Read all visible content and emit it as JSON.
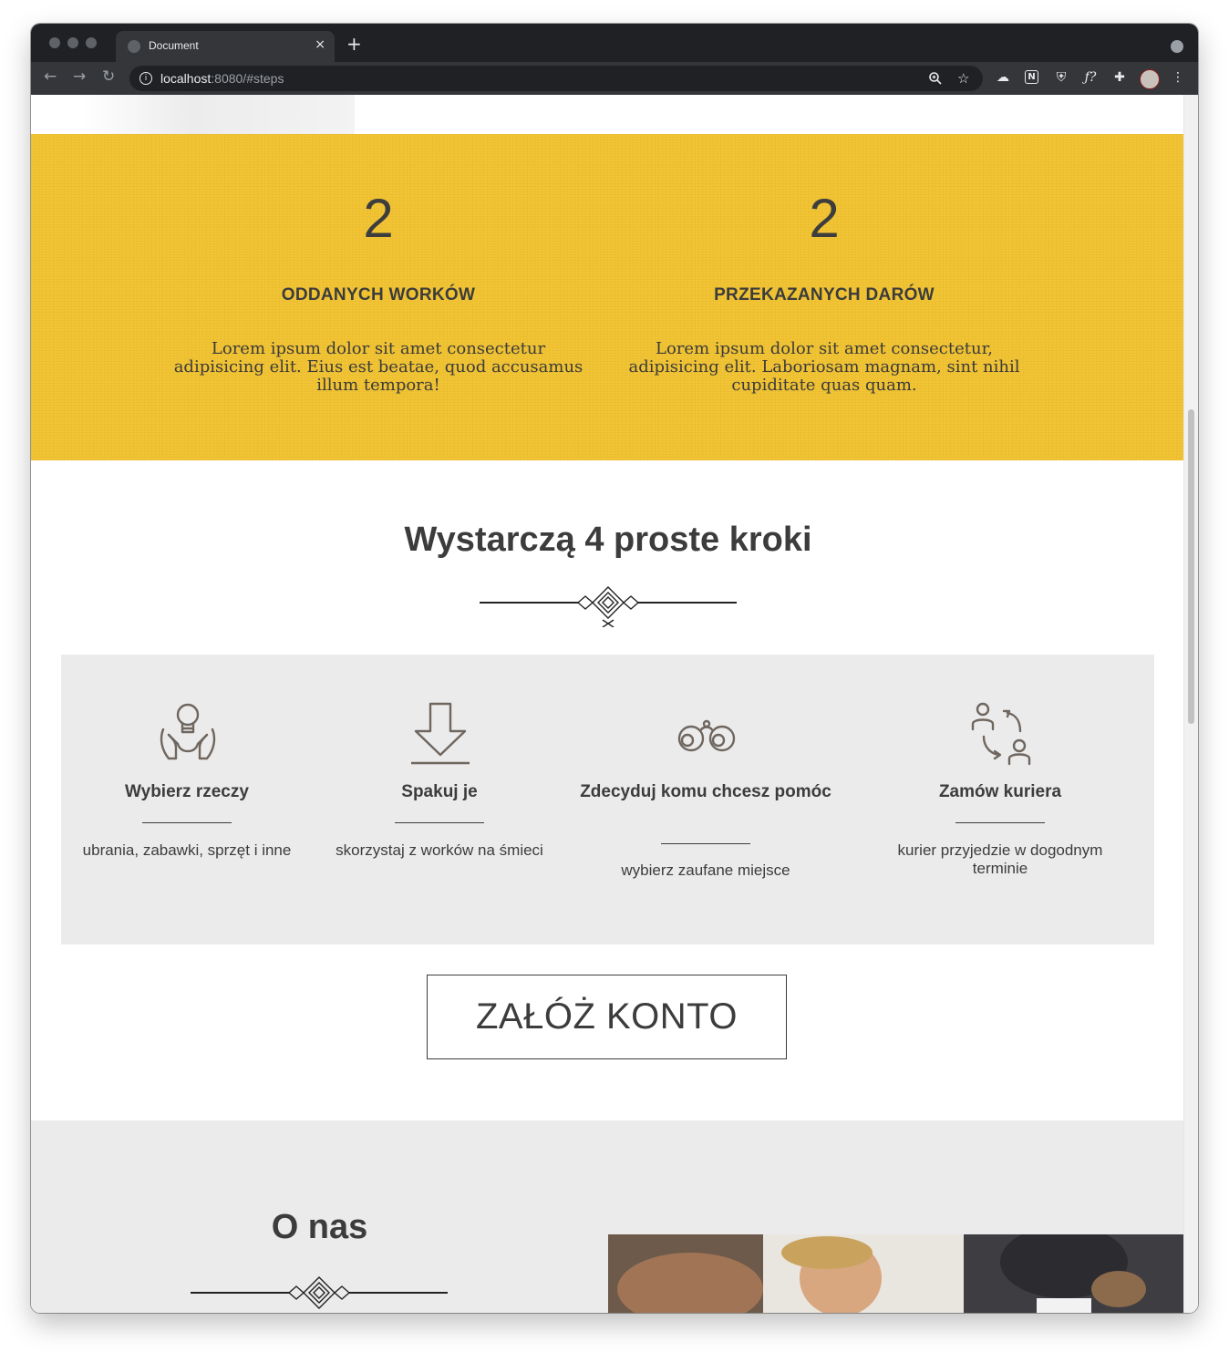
{
  "browser": {
    "tab_title": "Document",
    "tab_close": "×",
    "new_tab": "+",
    "url_host": "localhost",
    "url_rest": ":8080/#steps",
    "back": "←",
    "forward": "→",
    "reload": "↻"
  },
  "stats": {
    "background_color": "#f2c434",
    "items": [
      {
        "number": "2",
        "label": "ODDANYCH WORKÓW",
        "description": "Lorem ipsum dolor sit amet consectetur adipisicing elit. Eius est beatae, quod accusamus illum tempora!"
      },
      {
        "number": "2",
        "label": "PRZEKAZANYCH DARÓW",
        "description": "Lorem ipsum dolor sit amet consectetur, adipisicing elit. Laboriosam magnam, sint nihil cupiditate quas quam."
      }
    ]
  },
  "steps": {
    "title": "Wystarczą 4 proste kroki",
    "items": [
      {
        "icon": "hands-lightbulb-icon",
        "title": "Wybierz rzeczy",
        "description": "ubrania, zabawki, sprzęt i inne"
      },
      {
        "icon": "download-arrow-icon",
        "title": "Spakuj je",
        "description": "skorzystaj z worków na śmieci"
      },
      {
        "icon": "binoculars-icon",
        "title": "Zdecyduj komu chcesz pomóc",
        "description": "wybierz zaufane miejsce"
      },
      {
        "icon": "people-exchange-icon",
        "title": "Zamów kuriera",
        "description": "kurier przyjedzie w dogodnym terminie"
      }
    ]
  },
  "cta": {
    "label": "ZAŁÓŻ KONTO"
  },
  "about": {
    "title": "O nas"
  },
  "colors": {
    "text": "#3c3c3c",
    "section_gray": "#ebebeb"
  }
}
